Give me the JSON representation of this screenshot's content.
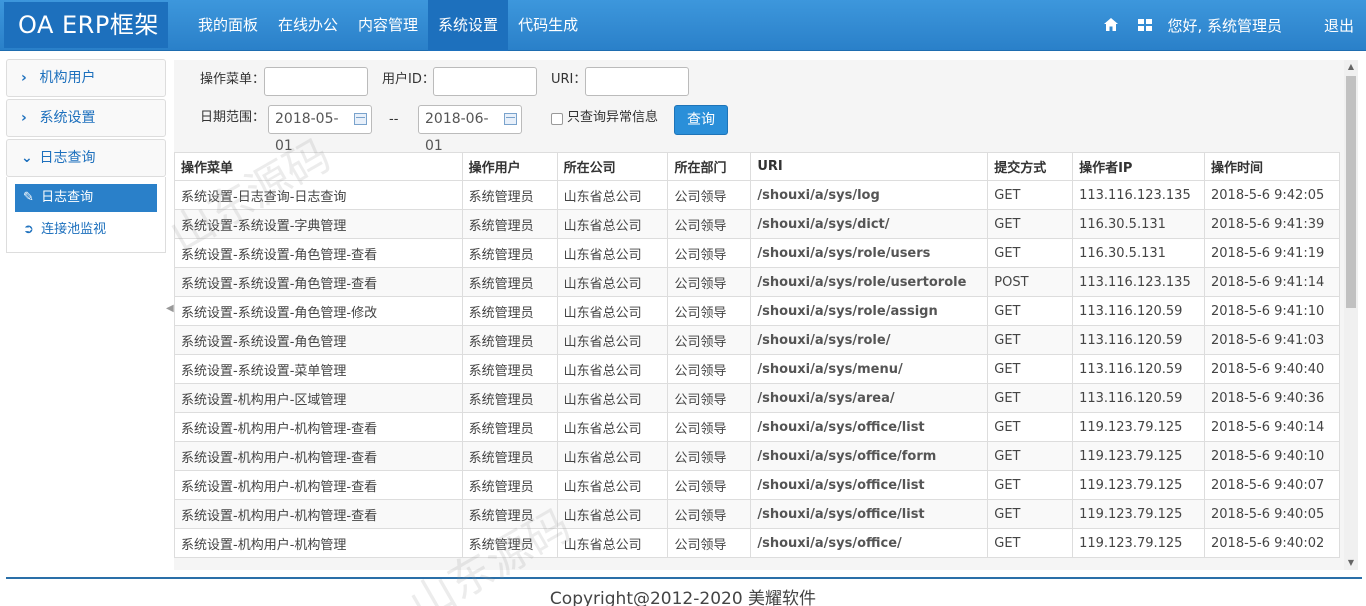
{
  "app": {
    "title": "OA ERP框架"
  },
  "nav": {
    "items": [
      "我的面板",
      "在线办公",
      "内容管理",
      "系统设置",
      "代码生成"
    ],
    "active_index": 3
  },
  "topright": {
    "greeting": "您好, 系统管理员",
    "logout": "退出"
  },
  "sidebar": {
    "groups": [
      "机构用户",
      "系统设置",
      "日志查询"
    ],
    "sub_items": [
      "日志查询",
      "连接池监视"
    ]
  },
  "filters": {
    "menu_label": "操作菜单：",
    "userid_label": "用户ID：",
    "uri_label": "URI：",
    "date_label": "日期范围：",
    "date_from": "2018-05-01",
    "date_sep": "--",
    "date_to": "2018-06-01",
    "exception_label": "只查询异常信息",
    "query_button": "查询"
  },
  "table": {
    "headers": [
      "操作菜单",
      "操作用户",
      "所在公司",
      "所在部门",
      "URI",
      "提交方式",
      "操作者IP",
      "操作时间"
    ],
    "rows": [
      [
        "系统设置-日志查询-日志查询",
        "系统管理员",
        "山东省总公司",
        "公司领导",
        "/shouxi/a/sys/log",
        "GET",
        "113.116.123.135",
        "2018-5-6 9:42:05"
      ],
      [
        "系统设置-系统设置-字典管理",
        "系统管理员",
        "山东省总公司",
        "公司领导",
        "/shouxi/a/sys/dict/",
        "GET",
        "116.30.5.131",
        "2018-5-6 9:41:39"
      ],
      [
        "系统设置-系统设置-角色管理-查看",
        "系统管理员",
        "山东省总公司",
        "公司领导",
        "/shouxi/a/sys/role/users",
        "GET",
        "116.30.5.131",
        "2018-5-6 9:41:19"
      ],
      [
        "系统设置-系统设置-角色管理-查看",
        "系统管理员",
        "山东省总公司",
        "公司领导",
        "/shouxi/a/sys/role/usertorole",
        "POST",
        "113.116.123.135",
        "2018-5-6 9:41:14"
      ],
      [
        "系统设置-系统设置-角色管理-修改",
        "系统管理员",
        "山东省总公司",
        "公司领导",
        "/shouxi/a/sys/role/assign",
        "GET",
        "113.116.120.59",
        "2018-5-6 9:41:10"
      ],
      [
        "系统设置-系统设置-角色管理",
        "系统管理员",
        "山东省总公司",
        "公司领导",
        "/shouxi/a/sys/role/",
        "GET",
        "113.116.120.59",
        "2018-5-6 9:41:03"
      ],
      [
        "系统设置-系统设置-菜单管理",
        "系统管理员",
        "山东省总公司",
        "公司领导",
        "/shouxi/a/sys/menu/",
        "GET",
        "113.116.120.59",
        "2018-5-6 9:40:40"
      ],
      [
        "系统设置-机构用户-区域管理",
        "系统管理员",
        "山东省总公司",
        "公司领导",
        "/shouxi/a/sys/area/",
        "GET",
        "113.116.120.59",
        "2018-5-6 9:40:36"
      ],
      [
        "系统设置-机构用户-机构管理-查看",
        "系统管理员",
        "山东省总公司",
        "公司领导",
        "/shouxi/a/sys/office/list",
        "GET",
        "119.123.79.125",
        "2018-5-6 9:40:14"
      ],
      [
        "系统设置-机构用户-机构管理-查看",
        "系统管理员",
        "山东省总公司",
        "公司领导",
        "/shouxi/a/sys/office/form",
        "GET",
        "119.123.79.125",
        "2018-5-6 9:40:10"
      ],
      [
        "系统设置-机构用户-机构管理-查看",
        "系统管理员",
        "山东省总公司",
        "公司领导",
        "/shouxi/a/sys/office/list",
        "GET",
        "119.123.79.125",
        "2018-5-6 9:40:07"
      ],
      [
        "系统设置-机构用户-机构管理-查看",
        "系统管理员",
        "山东省总公司",
        "公司领导",
        "/shouxi/a/sys/office/list",
        "GET",
        "119.123.79.125",
        "2018-5-6 9:40:05"
      ],
      [
        "系统设置-机构用户-机构管理",
        "系统管理员",
        "山东省总公司",
        "公司领导",
        "/shouxi/a/sys/office/",
        "GET",
        "119.123.79.125",
        "2018-5-6 9:40:02"
      ]
    ]
  },
  "footer": {
    "text": "Copyright@2012-2020 美耀软件"
  },
  "watermark": {
    "text": "山东源码"
  }
}
